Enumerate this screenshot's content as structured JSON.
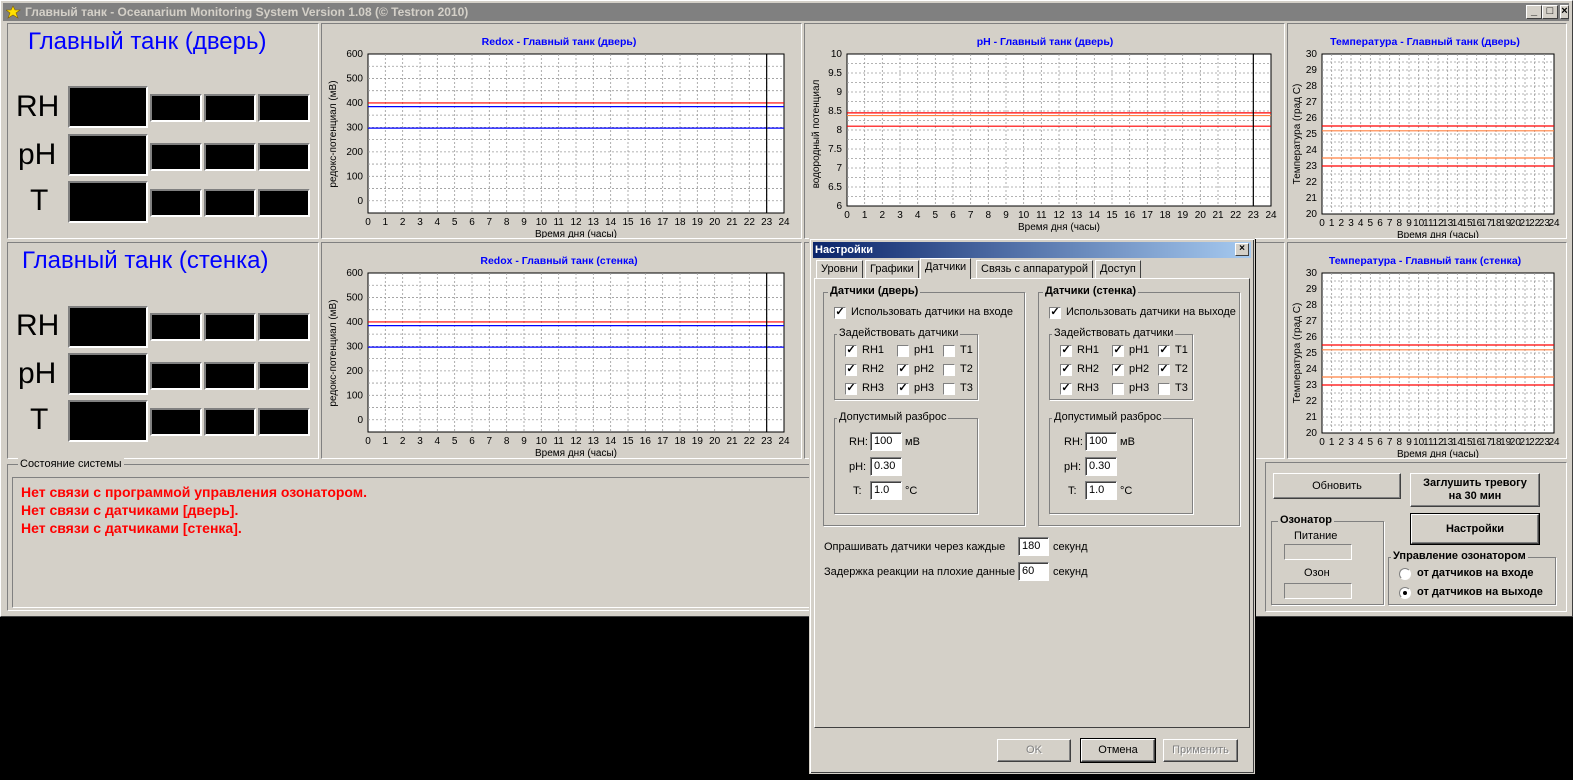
{
  "window": {
    "title": "Главный танк - Oceanarium Monitoring System  Version 1.08 (© Testron 2010)",
    "controls": {
      "minimize": "_",
      "maximize": "□",
      "close": "×"
    }
  },
  "tanks": [
    {
      "title": "Главный танк (дверь)",
      "rows": [
        "RH",
        "pH",
        "T"
      ]
    },
    {
      "title": "Главный танк (стенка)",
      "rows": [
        "RH",
        "pH",
        "T"
      ]
    }
  ],
  "chart_data": [
    {
      "id": "redox-door",
      "type": "line",
      "title": "Redox - Главный танк (дверь)",
      "xlabel": "Время дня (часы)",
      "ylabel": "редокс-потенциал (мВ)",
      "xlim": [
        0,
        24
      ],
      "ylim": [
        -50,
        600
      ],
      "yticks": [
        0,
        100,
        200,
        300,
        400,
        500,
        600
      ],
      "series": [
        {
          "color": "#ff0000",
          "values": [
            400,
            400
          ]
        },
        {
          "color": "#0000ff",
          "values": [
            385,
            385
          ]
        },
        {
          "color": "#0000ff",
          "values": [
            297,
            297
          ]
        }
      ],
      "marker_x": 23,
      "grid": true
    },
    {
      "id": "ph-door",
      "type": "line",
      "title": "pH - Главный танк (дверь)",
      "xlabel": "Время дня (часы)",
      "ylabel": "водородный потенциал",
      "xlim": [
        0,
        24
      ],
      "ylim": [
        6,
        10
      ],
      "yticks": [
        6,
        6.5,
        7,
        7.5,
        8,
        8.5,
        9,
        9.5,
        10
      ],
      "series": [
        {
          "color": "#ff0000",
          "values": [
            8.45,
            8.45
          ]
        },
        {
          "color": "#ff0000",
          "values": [
            8.1,
            8.1
          ]
        },
        {
          "color": "#ff8040",
          "values": [
            8.38,
            8.38
          ]
        }
      ],
      "marker_x": 23,
      "grid": true
    },
    {
      "id": "temp-door",
      "type": "line",
      "title": "Температура - Главный танк (дверь)",
      "xlabel": "Время дня (часы)",
      "ylabel": "Температура (град С)",
      "xlim": [
        0,
        24
      ],
      "ylim": [
        20,
        30
      ],
      "yticks": [
        20,
        21,
        22,
        23,
        24,
        25,
        26,
        27,
        28,
        29,
        30
      ],
      "series": [
        {
          "color": "#ff0000",
          "values": [
            25.5,
            25.5
          ]
        },
        {
          "color": "#ff8040",
          "values": [
            25.2,
            25.2
          ]
        },
        {
          "color": "#ff8040",
          "values": [
            23.5,
            23.5
          ]
        },
        {
          "color": "#ff0000",
          "values": [
            23.0,
            23.0
          ]
        }
      ],
      "grid": true
    },
    {
      "id": "redox-wall",
      "type": "line",
      "title": "Redox - Главный танк (стенка)",
      "xlabel": "Время дня (часы)",
      "ylabel": "редокс-потенциал (мВ)",
      "xlim": [
        0,
        24
      ],
      "ylim": [
        -50,
        600
      ],
      "yticks": [
        0,
        100,
        200,
        300,
        400,
        500,
        600
      ],
      "series": [
        {
          "color": "#ff0000",
          "values": [
            400,
            400
          ]
        },
        {
          "color": "#0000ff",
          "values": [
            385,
            385
          ]
        },
        {
          "color": "#0000ff",
          "values": [
            297,
            297
          ]
        }
      ],
      "marker_x": 23,
      "grid": true
    },
    {
      "id": "temp-wall",
      "type": "line",
      "title": "Температура - Главный танк (стенка)",
      "xlabel": "Время дня (часы)",
      "ylabel": "Температура (град С)",
      "xlim": [
        0,
        24
      ],
      "ylim": [
        20,
        30
      ],
      "yticks": [
        20,
        21,
        22,
        23,
        24,
        25,
        26,
        27,
        28,
        29,
        30
      ],
      "series": [
        {
          "color": "#ff0000",
          "values": [
            25.5,
            25.5
          ]
        },
        {
          "color": "#ff8040",
          "values": [
            25.2,
            25.2
          ]
        },
        {
          "color": "#ff8040",
          "values": [
            23.5,
            23.5
          ]
        },
        {
          "color": "#ff0000",
          "values": [
            23.0,
            23.0
          ]
        }
      ],
      "grid": true
    }
  ],
  "xticks": [
    "0",
    "1",
    "2",
    "3",
    "4",
    "5",
    "6",
    "7",
    "8",
    "9",
    "10",
    "11",
    "12",
    "13",
    "14",
    "15",
    "16",
    "17",
    "18",
    "19",
    "20",
    "21",
    "22",
    "23",
    "24"
  ],
  "status": {
    "label": "Состояние системы",
    "messages": [
      "Нет связи с программой управления озонатором.",
      "Нет связи с датчиками [дверь].",
      "Нет связи с датчиками [стенка]."
    ]
  },
  "controls": {
    "refresh": "Обновить",
    "silence": "Заглушить тревогу на 30 мин",
    "settings": "Настройки",
    "ozonator": {
      "label": "Озонатор",
      "power": "Питание",
      "ozone": "Озон"
    },
    "ozoneControl": {
      "label": "Управление озонатором",
      "opt1": "от датчиков на входе",
      "opt2": "от датчиков на выходе",
      "selected": "opt2"
    }
  },
  "dialog": {
    "title": "Настройки",
    "close": "×",
    "tabs": [
      "Уровни",
      "Графики",
      "Датчики",
      "Связь с аппаратурой",
      "Доступ"
    ],
    "activeTab": "Датчики",
    "groups": [
      {
        "title": "Датчики (дверь)",
        "useLabel": "Использовать датчики на входе",
        "use": true,
        "enableLabel": "Задействовать датчики",
        "sensors": [
          [
            "RH1",
            true
          ],
          [
            "pH1",
            false
          ],
          [
            "T1",
            false
          ],
          [
            "RH2",
            true
          ],
          [
            "pH2",
            true
          ],
          [
            "T2",
            false
          ],
          [
            "RH3",
            true
          ],
          [
            "pH3",
            true
          ],
          [
            "T3",
            false
          ]
        ],
        "tolLabel": "Допустимый разброс",
        "rhLabel": "RH:",
        "rh": "100",
        "rhUnit": "мВ",
        "phLabel": "pH:",
        "ph": "0.30",
        "tLabel": "T:",
        "t": "1.0",
        "tUnit": "°C"
      },
      {
        "title": "Датчики (стенка)",
        "useLabel": "Использовать датчики на выходе",
        "use": true,
        "enableLabel": "Задействовать датчики",
        "sensors": [
          [
            "RH1",
            true
          ],
          [
            "pH1",
            true
          ],
          [
            "T1",
            true
          ],
          [
            "RH2",
            true
          ],
          [
            "pH2",
            true
          ],
          [
            "T2",
            true
          ],
          [
            "RH3",
            true
          ],
          [
            "pH3",
            false
          ],
          [
            "T3",
            false
          ]
        ],
        "tolLabel": "Допустимый разброс",
        "rhLabel": "RH:",
        "rh": "100",
        "rhUnit": "мВ",
        "phLabel": "pH:",
        "ph": "0.30",
        "tLabel": "T:",
        "t": "1.0",
        "tUnit": "°C"
      }
    ],
    "pollLabel": "Опрашивать датчики через каждые",
    "poll": "180",
    "pollUnit": "секунд",
    "delayLabel": "Задержка реакции на плохие данные",
    "delay": "60",
    "delayUnit": "секунд",
    "buttons": {
      "ok": "OK",
      "cancel": "Отмена",
      "apply": "Применить"
    },
    "check": "✓"
  }
}
